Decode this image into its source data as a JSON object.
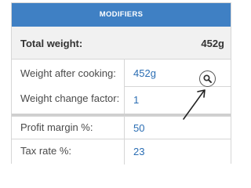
{
  "header": {
    "title": "MODIFIERS"
  },
  "total": {
    "label": "Total weight:",
    "value": "452g"
  },
  "fields": [
    {
      "label": "Weight after cooking:",
      "value": "452g"
    },
    {
      "label": "Weight change factor:",
      "value": "1"
    },
    {
      "label": "Profit margin %:",
      "value": "50"
    },
    {
      "label": "Tax rate %:",
      "value": "23"
    }
  ],
  "icons": {
    "search": "search-icon",
    "annotation": "arrow-icon"
  },
  "colors": {
    "header_bg": "#3f80c4",
    "value_text": "#2a6db3",
    "total_bg": "#f1f1f1"
  }
}
